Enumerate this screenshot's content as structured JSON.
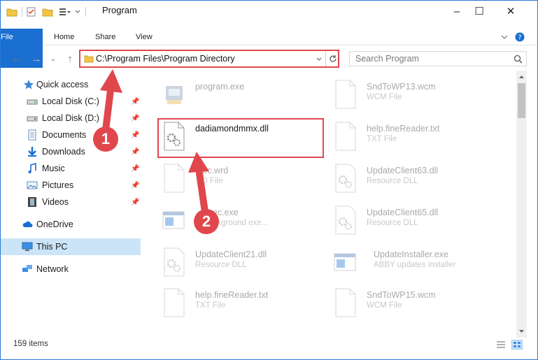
{
  "window": {
    "title": "Program",
    "controls": {
      "minimize": "–",
      "maximize": "☐",
      "close": "✕"
    }
  },
  "ribbon": {
    "tabs": [
      "File",
      "Home",
      "Share",
      "View"
    ]
  },
  "address": {
    "path": "C:\\Program Files\\Program Directory",
    "search_placeholder": "Search Program"
  },
  "sidebar": {
    "items": [
      {
        "label": "Quick access",
        "icon": "star-icon",
        "pinned": false
      },
      {
        "label": "Local Disk (C:)",
        "icon": "drive-icon",
        "pinned": true
      },
      {
        "label": "Local Disk (D:)",
        "icon": "drive-icon",
        "pinned": true
      },
      {
        "label": "Documents",
        "icon": "documents-icon",
        "pinned": true
      },
      {
        "label": "Downloads",
        "icon": "download-icon",
        "pinned": true
      },
      {
        "label": "Music",
        "icon": "music-icon",
        "pinned": true
      },
      {
        "label": "Pictures",
        "icon": "pictures-icon",
        "pinned": true
      },
      {
        "label": "Videos",
        "icon": "videos-icon",
        "pinned": true
      },
      {
        "label": "OneDrive",
        "icon": "cloud-icon",
        "pinned": false
      },
      {
        "label": "This PC",
        "icon": "computer-icon",
        "pinned": false,
        "selected": true
      },
      {
        "label": "Network",
        "icon": "network-icon",
        "pinned": false
      }
    ]
  },
  "files": [
    {
      "name": "program.exe",
      "type": "",
      "icon": "exe-icon",
      "faded": true
    },
    {
      "name": "SndToWP13.wcm",
      "type": "WCM File",
      "icon": "doc-icon",
      "faded": true
    },
    {
      "name": "dadiamondmmx.dll",
      "type": "",
      "icon": "dll-icon",
      "faded": false
    },
    {
      "name": "help.fineReader.txt",
      "type": "TXT File",
      "icon": "doc-icon",
      "faded": true
    },
    {
      "name": "...ec.wrd",
      "type": "...D File",
      "icon": "doc-icon",
      "faded": true
    },
    {
      "name": "UpdateClient63.dll",
      "type": "Resource DLL",
      "icon": "dll-icon",
      "faded": true
    },
    {
      "name": "...Exec.exe",
      "type": "... background exe...",
      "icon": "window-icon",
      "faded": true
    },
    {
      "name": "UpdateClient65.dll",
      "type": "Resource DLL",
      "icon": "dll-icon",
      "faded": true
    },
    {
      "name": "UpdateClient21.dll",
      "type": "Resource DLL",
      "icon": "dll-icon",
      "faded": true
    },
    {
      "name": "UpdateInstaller.exe",
      "type": "ABBY updates installer",
      "icon": "window-icon",
      "faded": true
    },
    {
      "name": "help.fineReader.txt",
      "type": "TXT File",
      "icon": "doc-icon",
      "faded": true
    },
    {
      "name": "SndToWP15.wcm",
      "type": "WCM File",
      "icon": "doc-icon",
      "faded": true
    }
  ],
  "status": {
    "item_count": "159 items"
  },
  "annotations": {
    "step1": "1",
    "step2": "2"
  }
}
